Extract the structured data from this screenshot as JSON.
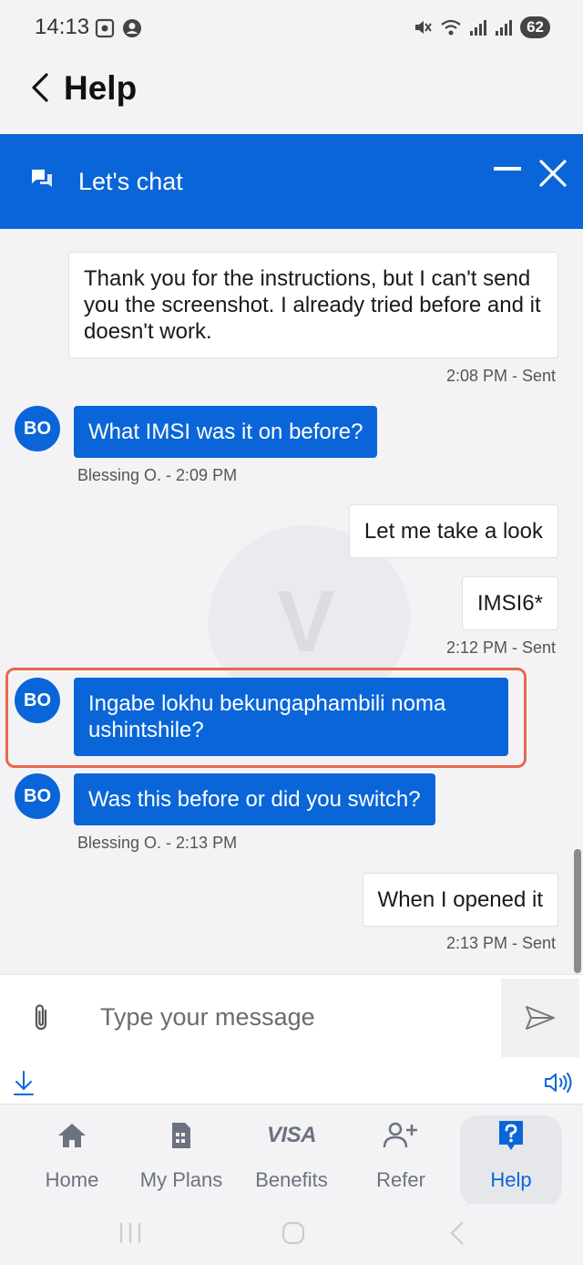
{
  "status_bar": {
    "time": "14:13",
    "battery": "62"
  },
  "header": {
    "title": "Help"
  },
  "chat_header": {
    "title": "Let's chat"
  },
  "watermark_letter": "V",
  "messages": [
    {
      "text": "Thank you for the instructions, but I can't send you the screenshot. I already tried before and it doesn't work.",
      "meta": "2:08 PM - Sent"
    },
    {
      "avatar": "BO",
      "text": "What IMSI was it on before?",
      "meta": "Blessing O. - 2:09 PM"
    },
    {
      "text": "Let me take a look"
    },
    {
      "text": "IMSI6*",
      "meta": "2:12 PM - Sent"
    },
    {
      "avatar": "BO",
      "text": "Ingabe lokhu bekungaphambili noma ushintshile?"
    },
    {
      "avatar": "BO",
      "text": "Was this before or did you switch?",
      "meta": "Blessing O. - 2:13 PM"
    },
    {
      "text": "When I opened it",
      "meta": "2:13 PM - Sent"
    }
  ],
  "input": {
    "placeholder": "Type your message"
  },
  "nav": [
    {
      "label": "Home",
      "icon": "home-icon"
    },
    {
      "label": "My Plans",
      "icon": "sim-card-icon"
    },
    {
      "label": "Benefits",
      "icon": "visa-icon",
      "icon_text": "VISA"
    },
    {
      "label": "Refer",
      "icon": "add-person-icon"
    },
    {
      "label": "Help",
      "icon": "help-icon",
      "active": true
    }
  ],
  "colors": {
    "accent": "#0a66d8",
    "highlight": "#e8684d"
  }
}
